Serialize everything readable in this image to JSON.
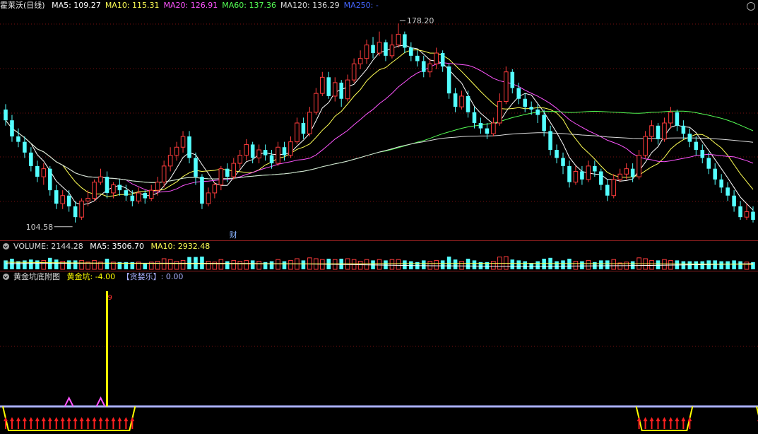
{
  "main": {
    "stock": "霍莱沃",
    "period": "(日线)",
    "ma": [
      {
        "label": "MA5: 109.27",
        "color": "#ffffff"
      },
      {
        "label": "MA10: 115.31",
        "color": "#ffff55"
      },
      {
        "label": "MA20: 126.91",
        "color": "#ff55ff"
      },
      {
        "label": "MA60: 137.36",
        "color": "#55ff55"
      },
      {
        "label": "MA120: 136.29",
        "color": "#dddddd"
      },
      {
        "label": "MA250: -",
        "color": "#4466ff"
      }
    ],
    "high_label": "178.20",
    "low_label": "104.58",
    "event_marker": "财"
  },
  "volume": {
    "title": "VOLUME: 2144.28",
    "ma5": "MA5: 3506.70",
    "ma10": "MA10: 2932.48"
  },
  "indicator": {
    "title": "黄金坑底附图",
    "golden": "黄金坑: -4.00",
    "greedy": "【贪婪乐】: 0.00",
    "spike_label": "9"
  },
  "colors": {
    "up": "#ff3c3c",
    "down": "#54ffff",
    "bg": "#000000",
    "grid": "#7a1010"
  },
  "chart_data": {
    "type": "candlestick",
    "title": "霍莱沃 (日线)",
    "ylim": [
      100,
      182
    ],
    "candles": [
      [
        146,
        142,
        148,
        140
      ],
      [
        142,
        136,
        144,
        134
      ],
      [
        136,
        134,
        139,
        132
      ],
      [
        134,
        130,
        136,
        128
      ],
      [
        130,
        125,
        132,
        123
      ],
      [
        125,
        121,
        127,
        119
      ],
      [
        121,
        124,
        126,
        118
      ],
      [
        124,
        116,
        125,
        114
      ],
      [
        116,
        111,
        118,
        109
      ],
      [
        111,
        114,
        116,
        109
      ],
      [
        114,
        110,
        116,
        108
      ],
      [
        110,
        106,
        112,
        104
      ],
      [
        106,
        112,
        113,
        105
      ],
      [
        112,
        113,
        116,
        110
      ],
      [
        113,
        119,
        120,
        112
      ],
      [
        119,
        121,
        124,
        118
      ],
      [
        121,
        115,
        123,
        113
      ],
      [
        115,
        118,
        119,
        113
      ],
      [
        118,
        116,
        120,
        114
      ],
      [
        116,
        114,
        118,
        112
      ],
      [
        114,
        112,
        116,
        110
      ],
      [
        112,
        115,
        117,
        111
      ],
      [
        115,
        113,
        116,
        111
      ],
      [
        113,
        116,
        118,
        112
      ],
      [
        116,
        119,
        121,
        114
      ],
      [
        119,
        125,
        127,
        117
      ],
      [
        125,
        129,
        132,
        123
      ],
      [
        129,
        132,
        134,
        127
      ],
      [
        132,
        136,
        138,
        130
      ],
      [
        136,
        128,
        138,
        126
      ],
      [
        128,
        121,
        130,
        118
      ],
      [
        121,
        111,
        122,
        109
      ],
      [
        111,
        115,
        117,
        110
      ],
      [
        115,
        118,
        119,
        113
      ],
      [
        118,
        124,
        125,
        116
      ],
      [
        124,
        121,
        126,
        119
      ],
      [
        121,
        126,
        128,
        120
      ],
      [
        126,
        129,
        131,
        124
      ],
      [
        129,
        133,
        135,
        127
      ],
      [
        133,
        128,
        134,
        126
      ],
      [
        128,
        131,
        133,
        126
      ],
      [
        131,
        129,
        133,
        127
      ],
      [
        129,
        126,
        131,
        124
      ],
      [
        126,
        132,
        134,
        125
      ],
      [
        132,
        129,
        134,
        127
      ],
      [
        129,
        134,
        136,
        128
      ],
      [
        134,
        141,
        143,
        133
      ],
      [
        141,
        137,
        143,
        135
      ],
      [
        137,
        145,
        147,
        136
      ],
      [
        145,
        152,
        154,
        144
      ],
      [
        152,
        158,
        160,
        151
      ],
      [
        158,
        151,
        160,
        150
      ],
      [
        151,
        156,
        158,
        149
      ],
      [
        156,
        150,
        157,
        147
      ],
      [
        150,
        157,
        159,
        149
      ],
      [
        157,
        163,
        165,
        156
      ],
      [
        163,
        165,
        168,
        161
      ],
      [
        165,
        170,
        172,
        163
      ],
      [
        170,
        167,
        173,
        165
      ],
      [
        167,
        171,
        175,
        166
      ],
      [
        171,
        166,
        172,
        164
      ],
      [
        166,
        170,
        174,
        165
      ],
      [
        170,
        174,
        178,
        169
      ],
      [
        174,
        169,
        175,
        167
      ],
      [
        169,
        166,
        171,
        164
      ],
      [
        166,
        164,
        168,
        162
      ],
      [
        164,
        160,
        166,
        158
      ],
      [
        160,
        163,
        165,
        158
      ],
      [
        163,
        167,
        169,
        161
      ],
      [
        167,
        162,
        168,
        160
      ],
      [
        162,
        152,
        163,
        150
      ],
      [
        152,
        147,
        154,
        145
      ],
      [
        147,
        151,
        153,
        146
      ],
      [
        151,
        145,
        153,
        143
      ],
      [
        145,
        141,
        147,
        139
      ],
      [
        141,
        139,
        143,
        137
      ],
      [
        139,
        137,
        141,
        135
      ],
      [
        137,
        141,
        143,
        136
      ],
      [
        141,
        149,
        152,
        140
      ],
      [
        149,
        160,
        162,
        148
      ],
      [
        160,
        154,
        161,
        152
      ],
      [
        154,
        150,
        156,
        148
      ],
      [
        150,
        147,
        152,
        145
      ],
      [
        147,
        146,
        149,
        144
      ],
      [
        146,
        144,
        148,
        141
      ],
      [
        144,
        138,
        146,
        136
      ],
      [
        138,
        131,
        140,
        129
      ],
      [
        131,
        128,
        133,
        126
      ],
      [
        128,
        125,
        130,
        122
      ],
      [
        125,
        119,
        127,
        117
      ],
      [
        119,
        123,
        125,
        118
      ],
      [
        123,
        120,
        125,
        118
      ],
      [
        120,
        125,
        127,
        119
      ],
      [
        125,
        123,
        127,
        121
      ],
      [
        123,
        118,
        124,
        116
      ],
      [
        118,
        114,
        120,
        112
      ],
      [
        114,
        120,
        122,
        113
      ],
      [
        120,
        122,
        124,
        119
      ],
      [
        122,
        124,
        126,
        120
      ],
      [
        124,
        121,
        126,
        119
      ],
      [
        121,
        129,
        131,
        120
      ],
      [
        129,
        136,
        138,
        128
      ],
      [
        136,
        140,
        142,
        134
      ],
      [
        140,
        135,
        141,
        133
      ],
      [
        135,
        141,
        143,
        134
      ],
      [
        141,
        145,
        147,
        139
      ],
      [
        145,
        140,
        146,
        138
      ],
      [
        140,
        137,
        142,
        135
      ],
      [
        137,
        134,
        139,
        132
      ],
      [
        134,
        131,
        136,
        129
      ],
      [
        131,
        128,
        133,
        126
      ],
      [
        128,
        124,
        130,
        122
      ],
      [
        124,
        120,
        126,
        118
      ],
      [
        120,
        117,
        122,
        115
      ],
      [
        117,
        114,
        119,
        112
      ],
      [
        114,
        110,
        116,
        108
      ],
      [
        110,
        106,
        112,
        105
      ],
      [
        106,
        108,
        111,
        105
      ],
      [
        108,
        105,
        110,
        104
      ]
    ],
    "ma_lines": [
      "MA5",
      "MA10",
      "MA20",
      "MA60",
      "MA120"
    ],
    "indicator_spike_index": 16,
    "golden_pit_ranges": [
      [
        0,
        20
      ],
      [
        100,
        108
      ],
      [
        119,
        122
      ]
    ]
  }
}
